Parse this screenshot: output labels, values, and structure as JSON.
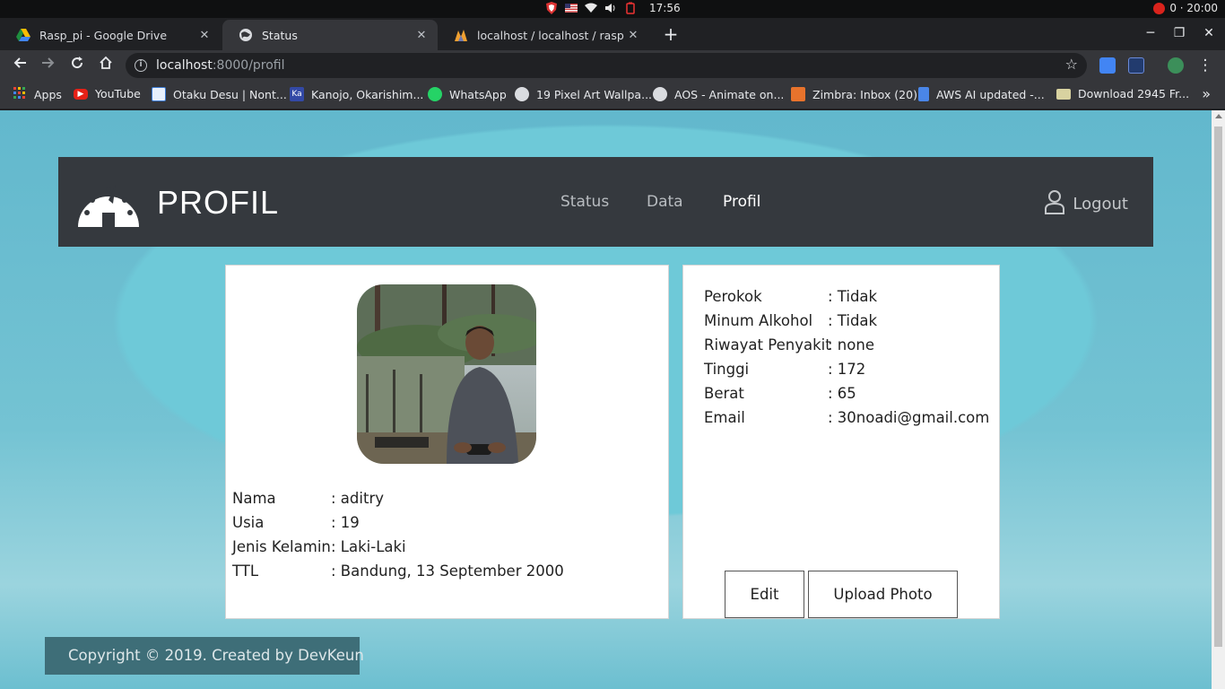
{
  "os": {
    "time": "17:56",
    "right_text": "0 · 20:00"
  },
  "tabs": [
    {
      "title": "Rasp_pi - Google Drive",
      "favicon": "google-drive-icon"
    },
    {
      "title": "Status",
      "favicon": "globe-icon",
      "active": true
    },
    {
      "title": "localhost / localhost / rasp / use",
      "favicon": "phpmyadmin-icon"
    }
  ],
  "address": {
    "host": "localhost",
    "path": ":8000/profil"
  },
  "bookmarks": [
    {
      "label": "Apps",
      "icon": "apps-grid-icon"
    },
    {
      "label": "YouTube",
      "icon": "youtube-icon"
    },
    {
      "label": "Otaku Desu | Nont...",
      "icon": "otakudesu-icon"
    },
    {
      "label": "Kanojo, Okarishim...",
      "icon": "kanojo-icon"
    },
    {
      "label": "WhatsApp",
      "icon": "whatsapp-icon"
    },
    {
      "label": "19 Pixel Art Wallpa...",
      "icon": "globe-icon"
    },
    {
      "label": "AOS - Animate on...",
      "icon": "globe-icon"
    },
    {
      "label": "Zimbra: Inbox (20)",
      "icon": "zimbra-icon"
    },
    {
      "label": "AWS AI updated -...",
      "icon": "docs-icon"
    },
    {
      "label": "Download 2945 Fr...",
      "icon": "download-icon"
    }
  ],
  "site": {
    "brand": "PROFIL",
    "nav": [
      {
        "label": "Status"
      },
      {
        "label": "Data"
      },
      {
        "label": "Profil",
        "current": true
      }
    ],
    "logout": "Logout"
  },
  "profile_left": [
    {
      "key": "Nama",
      "value": ": aditry"
    },
    {
      "key": "Usia",
      "value": ": 19"
    },
    {
      "key": "Jenis Kelamin",
      "value": ": Laki-Laki"
    },
    {
      "key": "TTL",
      "value": ": Bandung, 13 September 2000"
    }
  ],
  "profile_right": [
    {
      "key": "Perokok",
      "value": ": Tidak"
    },
    {
      "key": "Minum Alkohol",
      "value": ": Tidak"
    },
    {
      "key": "Riwayat Penyakit",
      "value": ": none"
    },
    {
      "key": "Tinggi",
      "value": ": 172"
    },
    {
      "key": "Berat",
      "value": ": 65"
    },
    {
      "key": "Email",
      "value": ": 30noadi@gmail.com"
    }
  ],
  "buttons": {
    "edit": "Edit",
    "upload": "Upload Photo"
  },
  "footer": "Copyright © 2019. Created by DevKeun",
  "colors": {
    "page_bg": "#6ec9d8",
    "header_bg": "#35393e",
    "footer_bg": "#3e6e78"
  }
}
